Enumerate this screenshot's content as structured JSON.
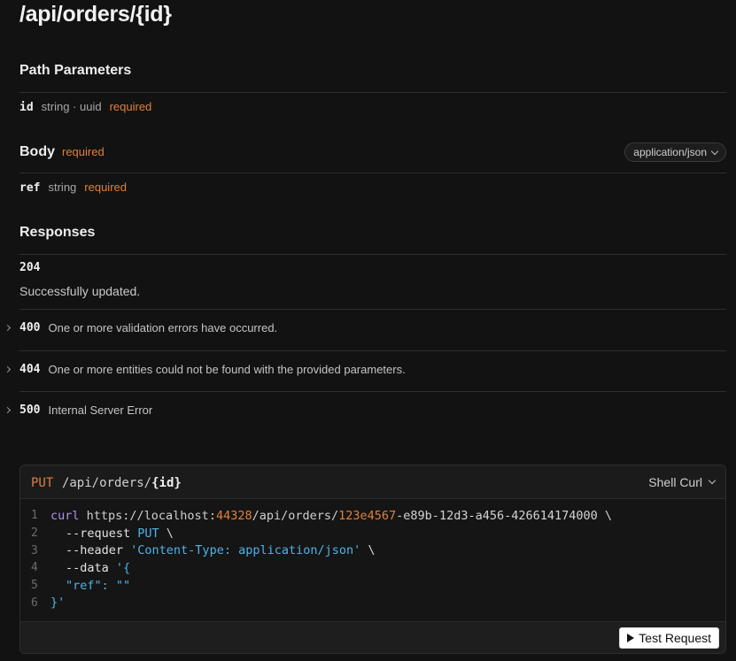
{
  "endpoint": {
    "title": "/api/orders/{id}"
  },
  "path_params": {
    "heading": "Path Parameters",
    "items": [
      {
        "name": "id",
        "type": "string · uuid",
        "required": "required"
      }
    ]
  },
  "body": {
    "heading": "Body",
    "required": "required",
    "content_type": "application/json",
    "items": [
      {
        "name": "ref",
        "type": "string",
        "required": "required"
      }
    ]
  },
  "responses": {
    "heading": "Responses",
    "expanded": {
      "code": "204",
      "description": "Successfully updated."
    },
    "collapsed": [
      {
        "code": "400",
        "description": "One or more validation errors have occurred."
      },
      {
        "code": "404",
        "description": "One or more entities could not be found with the provided parameters."
      },
      {
        "code": "500",
        "description": "Internal Server Error"
      }
    ]
  },
  "request_panel": {
    "method": "PUT",
    "path_prefix": "/api/orders/",
    "path_param": "{id}",
    "language": "Shell Curl",
    "line_numbers": [
      "1",
      "2",
      "3",
      "4",
      "5",
      "6"
    ],
    "code": {
      "l1_cmd": "curl",
      "l1_url_a": " https://localhost:",
      "l1_port": "44328",
      "l1_url_b": "/api/orders/",
      "l1_id_a": "123e4567",
      "l1_id_b": "-e89b-12d3-a456-426614174000",
      "l1_cont": " \\",
      "l2_flag": "--request",
      "l2_val": " PUT",
      "l2_cont": " \\",
      "l3_flag": "--header",
      "l3_val": " 'Content-Type: application/json'",
      "l3_cont": " \\",
      "l4_flag": "--data",
      "l4_val": " '{",
      "l5_key": "\"ref\"",
      "l5_sep": ": ",
      "l5_val": "\"\"",
      "l6_val": "}'"
    },
    "test_button": "Test Request"
  },
  "colors": {
    "accent_orange": "#e0803a",
    "string_blue": "#4fb3ea",
    "command_purple": "#a892f0",
    "background": "#121212"
  }
}
